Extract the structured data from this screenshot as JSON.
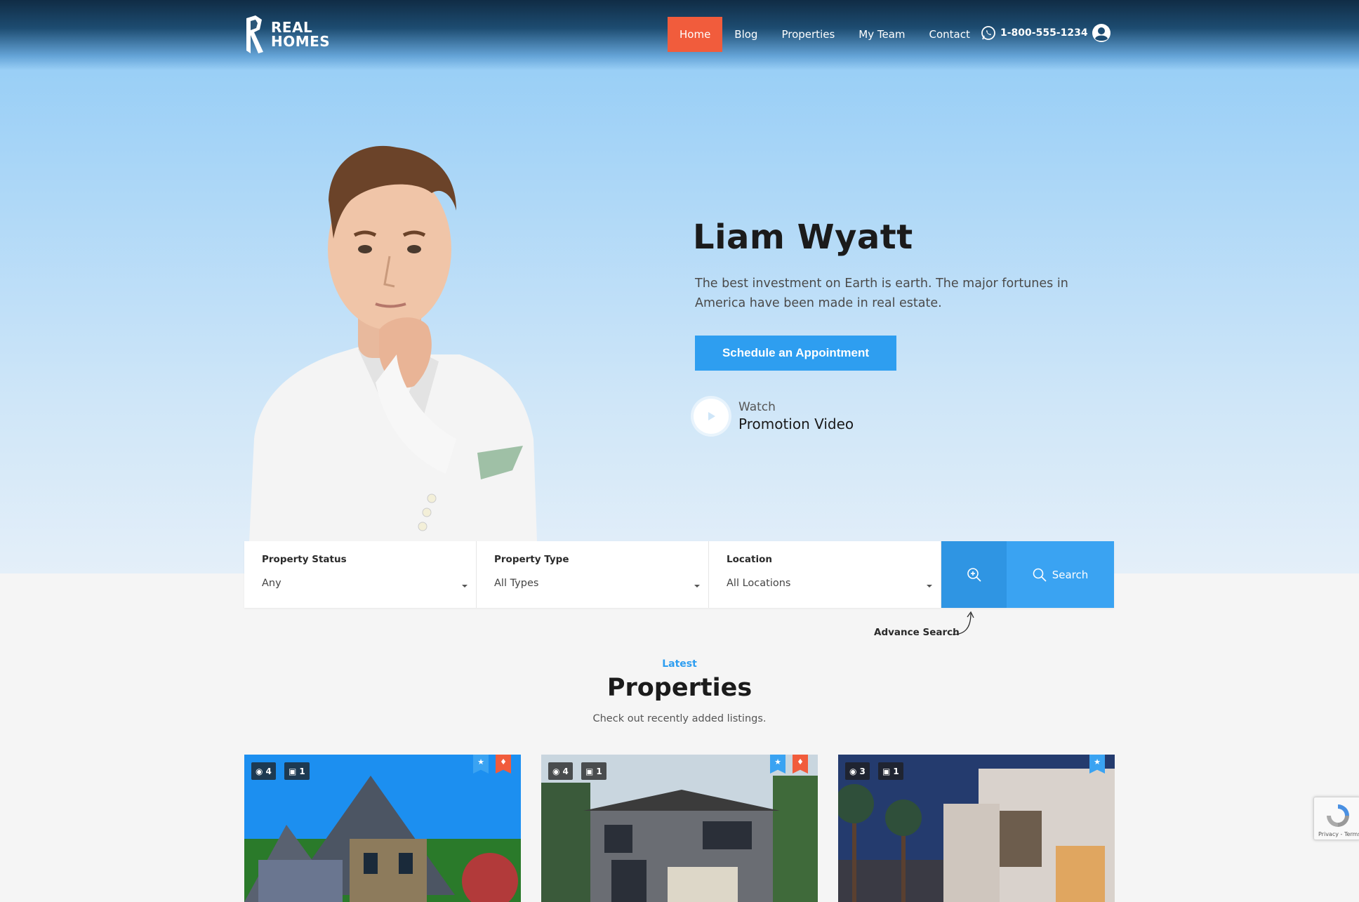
{
  "header": {
    "logo_line1": "REAL",
    "logo_line2": "HOMES",
    "nav": [
      "Home",
      "Blog",
      "Properties",
      "My Team",
      "Contact"
    ],
    "active_nav": "Home",
    "phone": "1-800-555-1234",
    "phone_icon": "whatsapp-icon",
    "user_icon": "user-circle-icon"
  },
  "hero": {
    "name": "Liam Wyatt",
    "description": "The best investment on Earth is earth. The major fortunes in America have been made in real estate.",
    "cta_label": "Schedule an Appointment",
    "video_small": "Watch",
    "video_big": "Promotion Video"
  },
  "search": {
    "fields": [
      {
        "label": "Property Status",
        "value": "Any"
      },
      {
        "label": "Property Type",
        "value": "All Types"
      },
      {
        "label": "Location",
        "value": "All Locations"
      }
    ],
    "search_label": "Search",
    "advance_label": "Advance Search"
  },
  "section": {
    "kicker": "Latest",
    "title": "Properties",
    "subtitle": "Check out recently added listings."
  },
  "cards": [
    {
      "photos": "4",
      "videos": "1",
      "featured": true,
      "hot": true
    },
    {
      "photos": "4",
      "videos": "1",
      "featured": true,
      "hot": true
    },
    {
      "photos": "3",
      "videos": "1",
      "featured": true,
      "hot": false
    }
  ],
  "recaptcha": {
    "text": "Privacy - Terms"
  },
  "colors": {
    "accent": "#2e9ef0",
    "nav_active": "#f15c3c"
  }
}
